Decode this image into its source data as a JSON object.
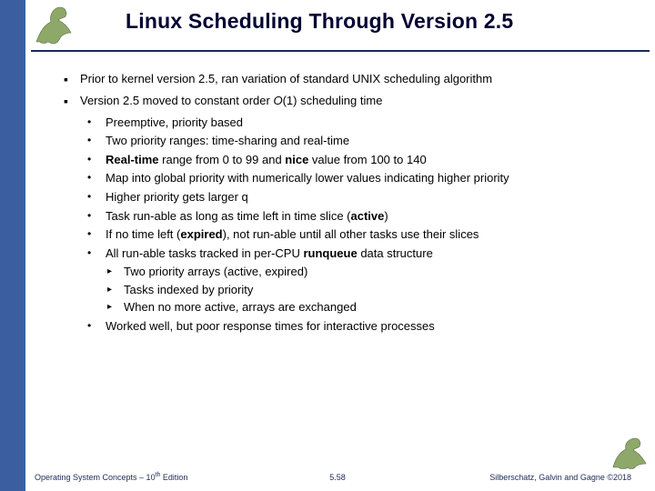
{
  "header": {
    "title": "Linux Scheduling Through Version 2.5"
  },
  "bullets": {
    "b1": "Prior to kernel version 2.5, ran variation of standard UNIX scheduling algorithm",
    "b2_pre": "Version 2.5 moved to constant order ",
    "b2_o": "O",
    "b2_post": "(1) scheduling time",
    "s1": "Preemptive, priority based",
    "s2": "Two priority ranges: time-sharing and real-time",
    "s3_a": "Real-time",
    "s3_b": " range from 0 to 99 and ",
    "s3_c": "nice",
    "s3_d": " value from 100 to 140",
    "s4": "Map into  global priority with numerically lower values indicating higher priority",
    "s5": "Higher priority gets larger q",
    "s6_a": "Task run-able as long as time left in time slice (",
    "s6_b": "active",
    "s6_c": ")",
    "s7_a": "If no time left (",
    "s7_b": "expired",
    "s7_c": "), not run-able until all other tasks use their slices",
    "s8_a": "All run-able tasks tracked in per-CPU ",
    "s8_b": "runqueue",
    "s8_c": " data structure",
    "t1": "Two priority arrays (active, expired)",
    "t2": "Tasks indexed by priority",
    "t3": "When no more active, arrays are exchanged",
    "s9": "Worked well, but poor response times for interactive processes"
  },
  "footer": {
    "left_a": "Operating System Concepts – 10",
    "left_sup": "th",
    "left_b": " Edition",
    "center": "5.58",
    "right": "Silberschatz, Galvin and Gagne ©2018"
  }
}
